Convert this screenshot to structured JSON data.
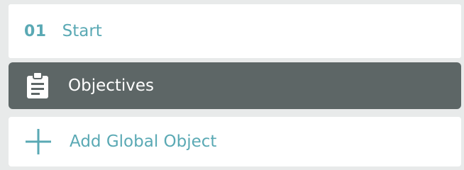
{
  "step": {
    "number": "01",
    "label": "Start"
  },
  "menu": {
    "objectives_label": "Objectives",
    "add_global_object_label": "Add Global Object"
  },
  "colors": {
    "accent": "#5aa9b4",
    "selected_background": "#5d6666",
    "panel_background": "#ffffff",
    "page_background": "#e8eaea"
  },
  "icons": {
    "objectives": "clipboard-icon",
    "add": "plus-icon"
  }
}
